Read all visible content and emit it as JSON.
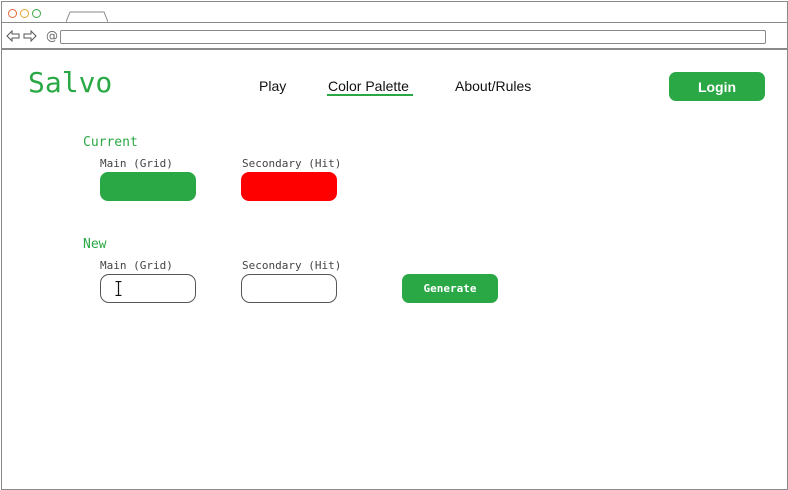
{
  "brand": {
    "name": "Salvo"
  },
  "nav": {
    "items": [
      {
        "label": "Play",
        "active": false
      },
      {
        "label": "Color Palette",
        "active": true
      },
      {
        "label": "About/Rules",
        "active": false
      }
    ],
    "login_label": "Login"
  },
  "browser": {
    "address_value": ""
  },
  "current": {
    "title": "Current",
    "main_label": "Main (Grid)",
    "secondary_label": "Secondary (Hit)",
    "main_color": "#2aa845",
    "secondary_color": "#ff0000"
  },
  "new": {
    "title": "New",
    "main_label": "Main (Grid)",
    "secondary_label": "Secondary (Hit)",
    "main_value": "",
    "secondary_value": "",
    "generate_label": "Generate"
  },
  "colors": {
    "accent": "#2aa845",
    "text": "#111111",
    "border": "#8a8a8a",
    "dot_red": "#e0663a",
    "dot_yellow": "#e3a42b",
    "dot_green": "#3ba844"
  }
}
